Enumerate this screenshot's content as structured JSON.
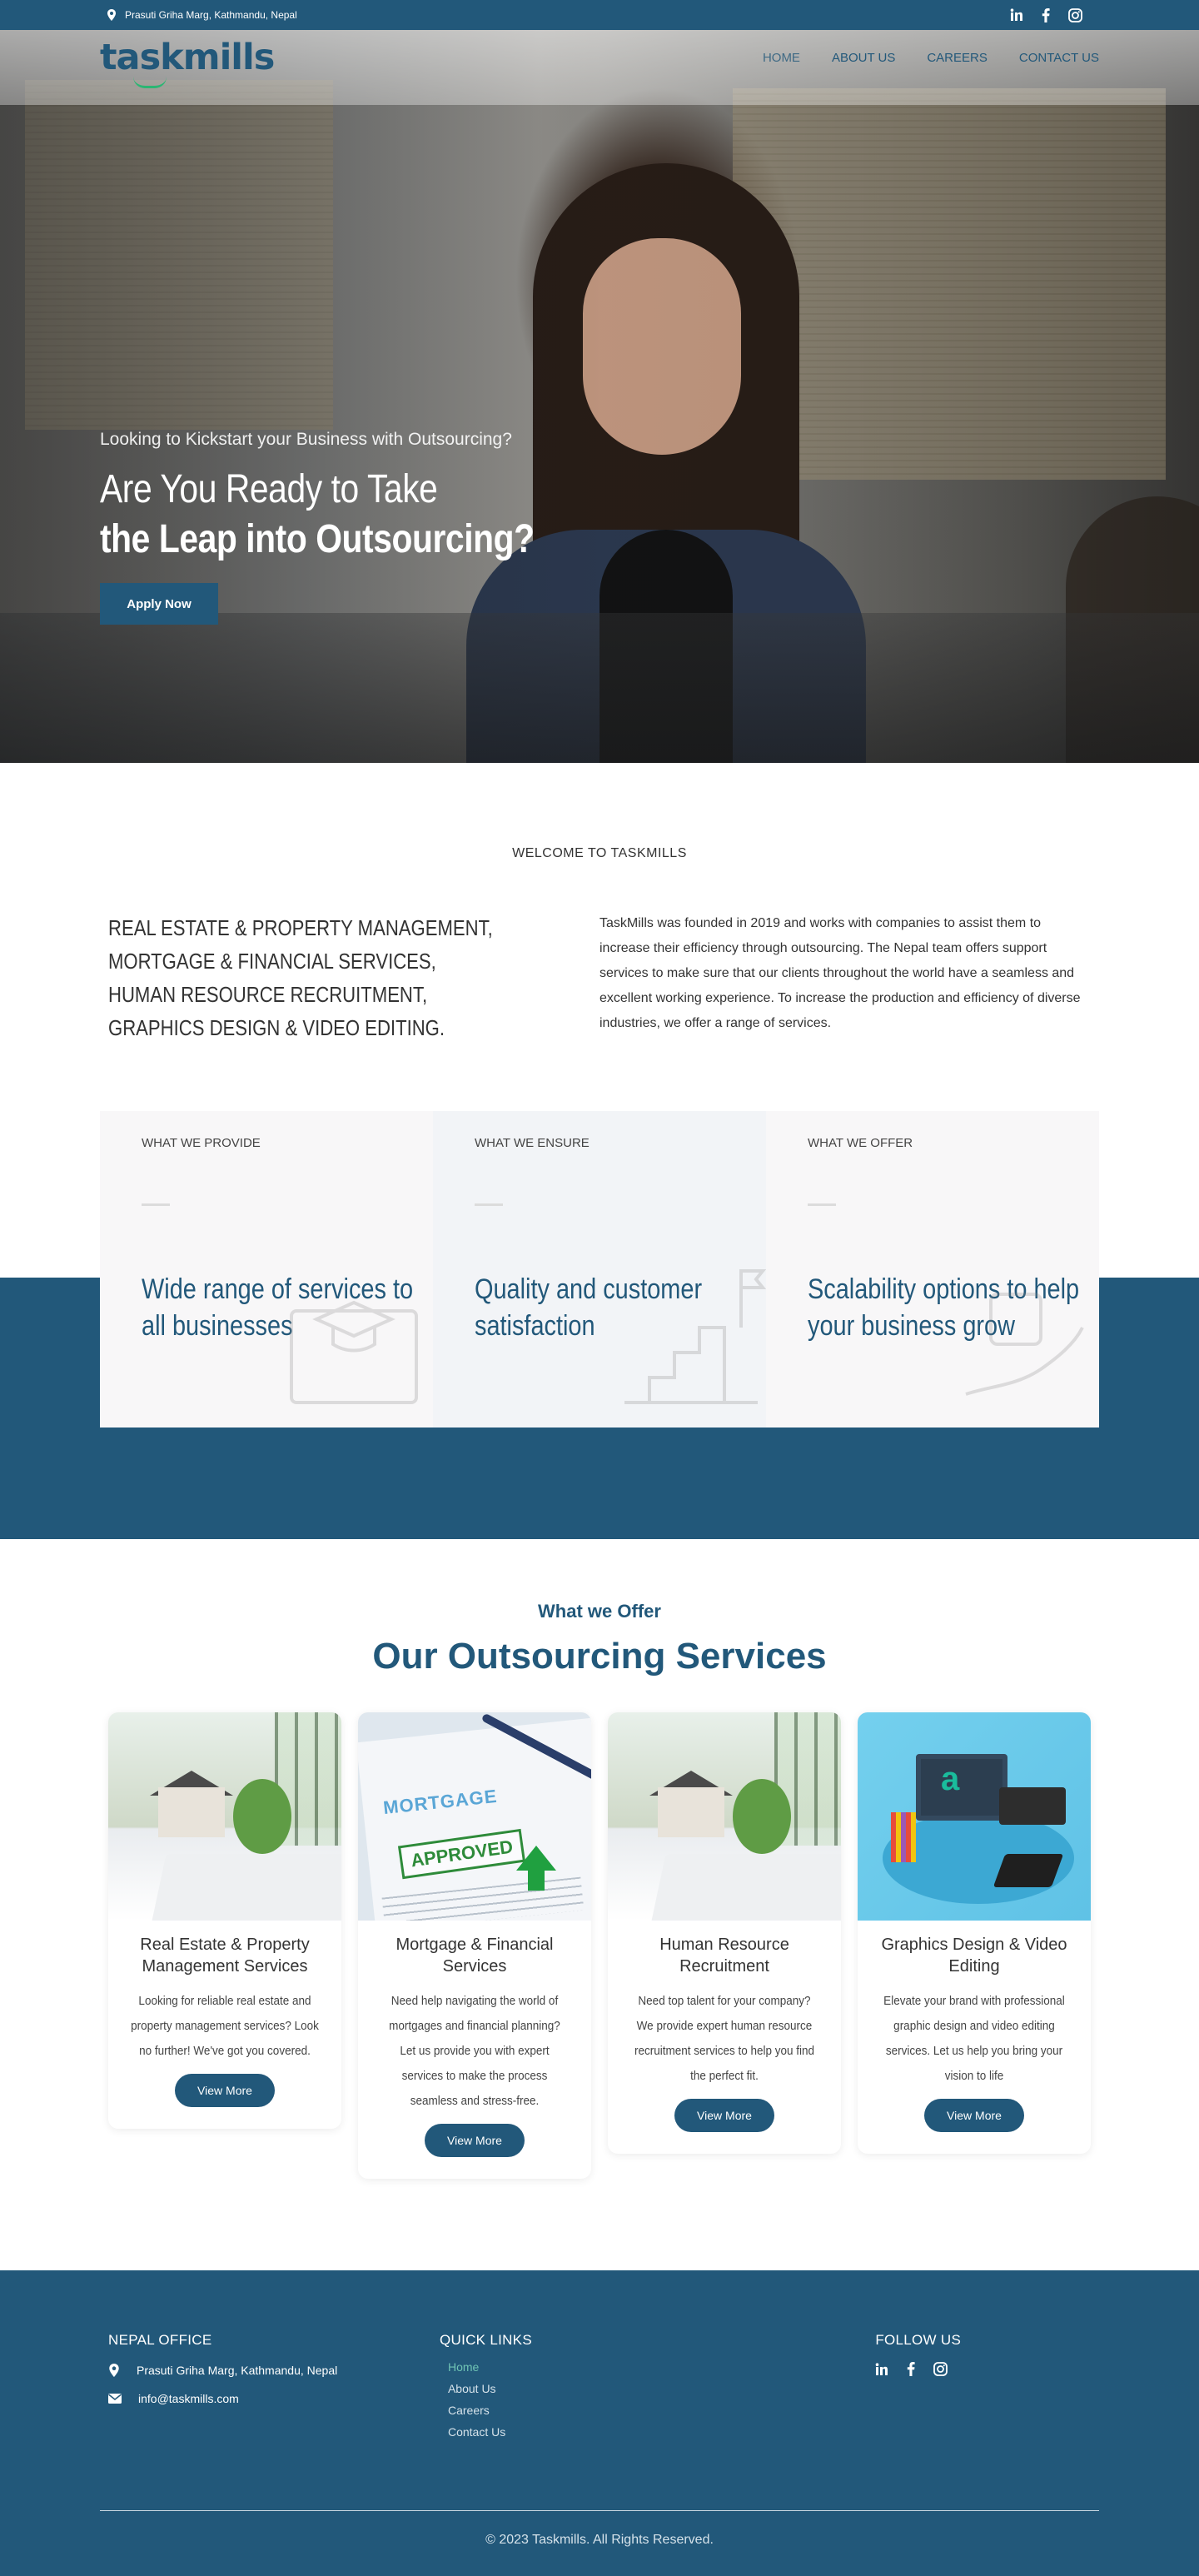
{
  "topbar": {
    "address": "Prasuti Griha Marg, Kathmandu, Nepal",
    "social_icons": [
      "linkedin-icon",
      "facebook-icon",
      "instagram-icon"
    ]
  },
  "brand": {
    "logo_text": "taskmills",
    "primary_color": "#22587a",
    "accent_color": "#2bb673"
  },
  "nav": {
    "items": [
      {
        "label": "HOME",
        "active": true
      },
      {
        "label": "ABOUT US"
      },
      {
        "label": "CAREERS"
      },
      {
        "label": "CONTACT US"
      }
    ]
  },
  "hero": {
    "kicker": "Looking to Kickstart your Business with Outsourcing?",
    "title_line1": "Are You Ready to Take",
    "title_line2": "the Leap into Outsourcing?",
    "cta_label": "Apply Now"
  },
  "welcome": {
    "eyebrow": "WELCOME TO TASKMILLS",
    "services_heading": "REAL ESTATE & PROPERTY MANAGEMENT, MORTGAGE & FINANCIAL SERVICES, HUMAN RESOURCE RECRUITMENT, GRAPHICS DESIGN & VIDEO EDITING.",
    "description": "TaskMills was founded in 2019 and works with companies to assist them to increase their efficiency through outsourcing. The Nepal team offers support services to make sure that our clients throughout the world have a seamless and excellent working experience. To increase the production and efficiency of diverse industries, we offer a range of services."
  },
  "features": [
    {
      "label": "WHAT WE PROVIDE",
      "title": "Wide range of services to all businesses",
      "icon": "graduation-cap-icon"
    },
    {
      "label": "WHAT WE ENSURE",
      "title": "Quality and customer satisfaction",
      "icon": "summit-flag-icon"
    },
    {
      "label": "WHAT WE OFFER",
      "title": "Scalability options to help your business grow",
      "icon": "growth-hand-icon"
    }
  ],
  "services": {
    "subtitle": "What we Offer",
    "title": "Our Outsourcing Services",
    "cards": [
      {
        "title": "Real Estate & Property Management Services",
        "text": "Looking for reliable real estate and property management services? Look no further! We've got you covered.",
        "button": "View More",
        "image": "house-laptop-image"
      },
      {
        "title": "Mortgage & Financial Services",
        "text": "Need help navigating the world of mortgages and financial planning? Let us provide you with expert services to make the process seamless and stress-free.",
        "button": "View More",
        "image": "mortgage-approved-image",
        "img_title": "MORTGAGE",
        "img_stamp": "APPROVED"
      },
      {
        "title": "Human Resource Recruitment",
        "text": "Need top talent for your company? We provide expert human resource recruitment services to help you find the perfect fit.",
        "button": "View More",
        "image": "house-laptop-image"
      },
      {
        "title": "Graphics Design & Video Editing",
        "text": "Elevate your brand with professional graphic design and video editing services. Let us help you bring your vision to life",
        "button": "View More",
        "image": "design-workstation-image",
        "img_letter": "a"
      }
    ]
  },
  "footer": {
    "office_heading": "NEPAL OFFICE",
    "office_address": "Prasuti Griha Marg, Kathmandu, Nepal",
    "office_email": "info@taskmills.com",
    "links_heading": "QUICK LINKS",
    "links": [
      {
        "label": "Home",
        "active": true
      },
      {
        "label": "About Us"
      },
      {
        "label": "Careers"
      },
      {
        "label": "Contact Us"
      }
    ],
    "follow_heading": "FOLLOW US",
    "copyright": "© 2023 Taskmills. All Rights Reserved."
  }
}
